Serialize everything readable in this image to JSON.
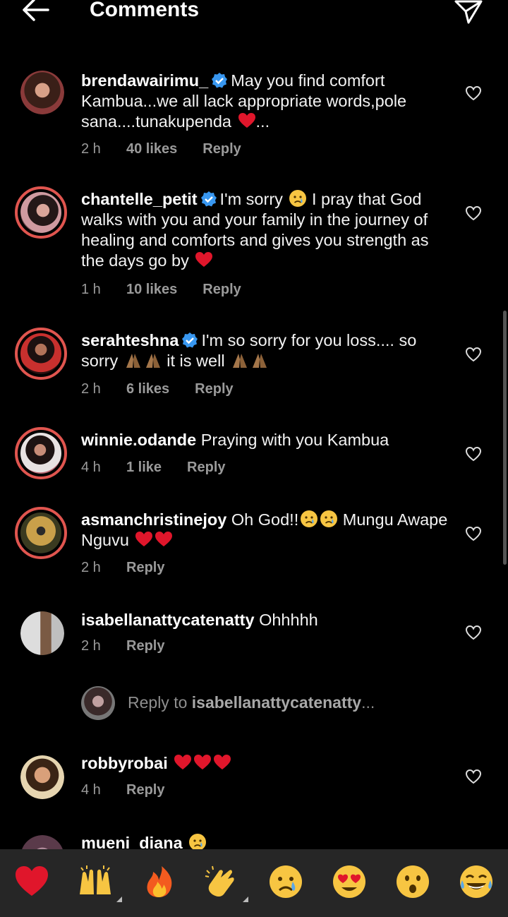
{
  "header": {
    "title": "Comments"
  },
  "comments": [
    {
      "username": "brendawairimu_",
      "verified": true,
      "text_a": "May you find comfort Kambua...we all lack appropriate words,pole sana....tunakupenda ",
      "text_b": "...",
      "emojis_a": [
        "red-heart"
      ],
      "time": "2 h",
      "likes": "40 likes",
      "reply": "Reply"
    },
    {
      "username": "chantelle_petit",
      "verified": true,
      "text_a": "I'm sorry ",
      "text_b": " I pray that God walks with you and your family in the journey of healing and comforts and gives you strength as the days go by ",
      "emojis_a": [
        "crying-face"
      ],
      "emojis_b": [
        "red-heart"
      ],
      "time": "1 h",
      "likes": "10 likes",
      "reply": "Reply"
    },
    {
      "username": "serahteshna",
      "verified": true,
      "text_a": "I'm so sorry for you loss.... so sorry ",
      "text_b": " it is well ",
      "emojis_a": [
        "folded-hands",
        "folded-hands"
      ],
      "emojis_b": [
        "folded-hands",
        "folded-hands"
      ],
      "time": "2 h",
      "likes": "6 likes",
      "reply": "Reply"
    },
    {
      "username": "winnie.odande",
      "verified": false,
      "text_a": "Praying with you Kambua",
      "time": "4 h",
      "likes": "1 like",
      "reply": "Reply"
    },
    {
      "username": "asmanchristinejoy",
      "verified": false,
      "text_a": "Oh God!!",
      "text_b": " Mungu Awape Nguvu ",
      "emojis_a": [
        "crying-face",
        "crying-face"
      ],
      "emojis_b": [
        "red-heart",
        "red-heart"
      ],
      "time": "2 h",
      "reply": "Reply"
    },
    {
      "username": "isabellanattycatenatty",
      "verified": false,
      "text_a": "Ohhhhh",
      "time": "2 h",
      "reply": "Reply"
    },
    {
      "username": "robbyrobai",
      "verified": false,
      "text_a": "",
      "emojis_a": [
        "red-heart",
        "red-heart",
        "red-heart"
      ],
      "time": "4 h",
      "reply": "Reply"
    },
    {
      "username": "mueni_diana",
      "verified": false,
      "text_a": "",
      "emojis_a": [
        "crying-face"
      ]
    }
  ],
  "reply_prompt": {
    "prefix": "Reply to ",
    "target": "isabellanattycatenatty",
    "suffix": "..."
  },
  "emoji_bar": [
    "red-heart",
    "raising-hands",
    "fire",
    "clapping-hands",
    "crying-face",
    "heart-eyes",
    "surprised-face",
    "tears-of-joy"
  ],
  "colors": {
    "background": "#000000",
    "accent_verified": "#3897f0",
    "story_ring": "#e0554f",
    "emoji_bar": "#262626"
  }
}
